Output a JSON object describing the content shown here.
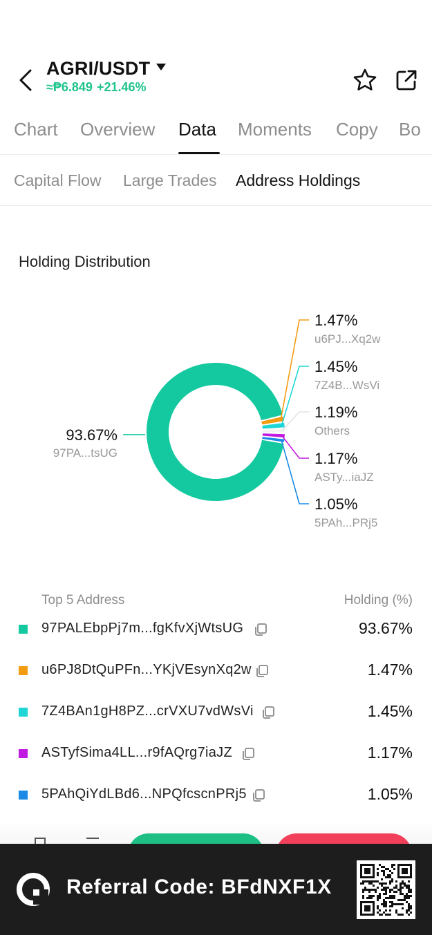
{
  "header": {
    "pair": "AGRI/USDT",
    "price": "≈₱6.849",
    "change": "+21.46%",
    "price_color": "#1ec48c"
  },
  "tabs": [
    {
      "label": "Chart"
    },
    {
      "label": "Overview"
    },
    {
      "label": "Data",
      "active": true
    },
    {
      "label": "Moments"
    },
    {
      "label": "Copy"
    },
    {
      "label": "Bo"
    }
  ],
  "subtabs": [
    {
      "label": "Capital Flow"
    },
    {
      "label": "Large Trades"
    },
    {
      "label": "Address Holdings",
      "active": true
    }
  ],
  "section_title": "Holding Distribution",
  "chart_data": {
    "type": "pie",
    "style": "donut",
    "slices": [
      {
        "label": "97PA...tsUG",
        "value": 93.67,
        "value_label": "93.67%",
        "color": "#14c9a0"
      },
      {
        "label": "u6PJ...Xq2w",
        "value": 1.47,
        "value_label": "1.47%",
        "color": "#f39c12"
      },
      {
        "label": "7Z4B...WsVi",
        "value": 1.45,
        "value_label": "1.45%",
        "color": "#1fd6d6"
      },
      {
        "label": "Others",
        "value": 1.19,
        "value_label": "1.19%",
        "color": "#f2f2f2"
      },
      {
        "label": "ASTy...iaJZ",
        "value": 1.17,
        "value_label": "1.17%",
        "color": "#c11ae0"
      },
      {
        "label": "5PAh...PRj5",
        "value": 1.05,
        "value_label": "1.05%",
        "color": "#1a8ae6"
      }
    ]
  },
  "table": {
    "col_address": "Top 5 Address",
    "col_holding": "Holding (%)",
    "rows": [
      {
        "address": "97PALEbpPj7m...fgKfvXjWtsUG",
        "pct": "93.67%",
        "color": "#14c9a0"
      },
      {
        "address": "u6PJ8DtQuPFn...YKjVEsynXq2w",
        "pct": "1.47%",
        "color": "#f39c12"
      },
      {
        "address": "7Z4BAn1gH8PZ...crVXU7vdWsVi",
        "pct": "1.45%",
        "color": "#1fd6d6"
      },
      {
        "address": "ASTyfSima4LL...r9fAQrg7iaJZ",
        "pct": "1.17%",
        "color": "#c11ae0"
      },
      {
        "address": "5PAhQiYdLBd6...NPQfcscnPRj5",
        "pct": "1.05%",
        "color": "#1a8ae6"
      }
    ]
  },
  "referral": {
    "text": "Referral Code: BFdNXF1X"
  },
  "icons": {
    "back": "chevron-left-icon",
    "caret": "caret-down-icon",
    "star": "star-icon",
    "share": "share-icon",
    "copy": "copy-icon",
    "logo": "brand-logo-icon",
    "qr": "qr-code-icon"
  }
}
